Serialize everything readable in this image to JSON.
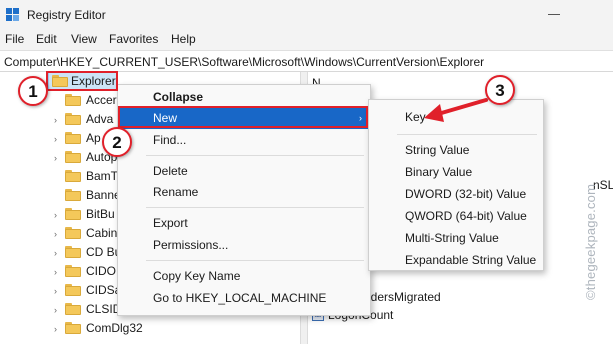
{
  "window": {
    "title": "Registry Editor"
  },
  "menubar": {
    "items": [
      "File",
      "Edit",
      "View",
      "Favorites",
      "Help"
    ]
  },
  "address": {
    "path": "Computer\\HKEY_CURRENT_USER\\Software\\Microsoft\\Windows\\CurrentVersion\\Explorer"
  },
  "tree": {
    "selected": "Explorer",
    "children": [
      "Accer",
      "Adva",
      "Ap",
      "Autop",
      "BamT",
      "Banne",
      "BitBu",
      "Cabin",
      "CD Bu",
      "CIDO",
      "CIDSa",
      "CLSID",
      "ComDlg32"
    ]
  },
  "values": {
    "header": "N",
    "partial_name": "nSL",
    "row1": "ownFoldersMigrated",
    "row2": "LogonCount",
    "row2_icon_text": "ab"
  },
  "context_menu": {
    "collapse": "Collapse",
    "new": "New",
    "find": "Find...",
    "delete": "Delete",
    "rename": "Rename",
    "export": "Export",
    "permissions": "Permissions...",
    "copy_key_name": "Copy Key Name",
    "go_to": "Go to HKEY_LOCAL_MACHINE"
  },
  "submenu": {
    "key": "Key",
    "string_value": "String Value",
    "binary_value": "Binary Value",
    "dword_value": "DWORD (32-bit) Value",
    "qword_value": "QWORD (64-bit) Value",
    "multi_string_value": "Multi-String Value",
    "expandable_string_value": "Expandable String Value"
  },
  "callouts": [
    "1",
    "2",
    "3"
  ],
  "watermark": "©thegeekpage.com",
  "colors": {
    "highlight": "#1867c7",
    "annotation_red": "#e0202a",
    "folder": "#f4c85a"
  }
}
